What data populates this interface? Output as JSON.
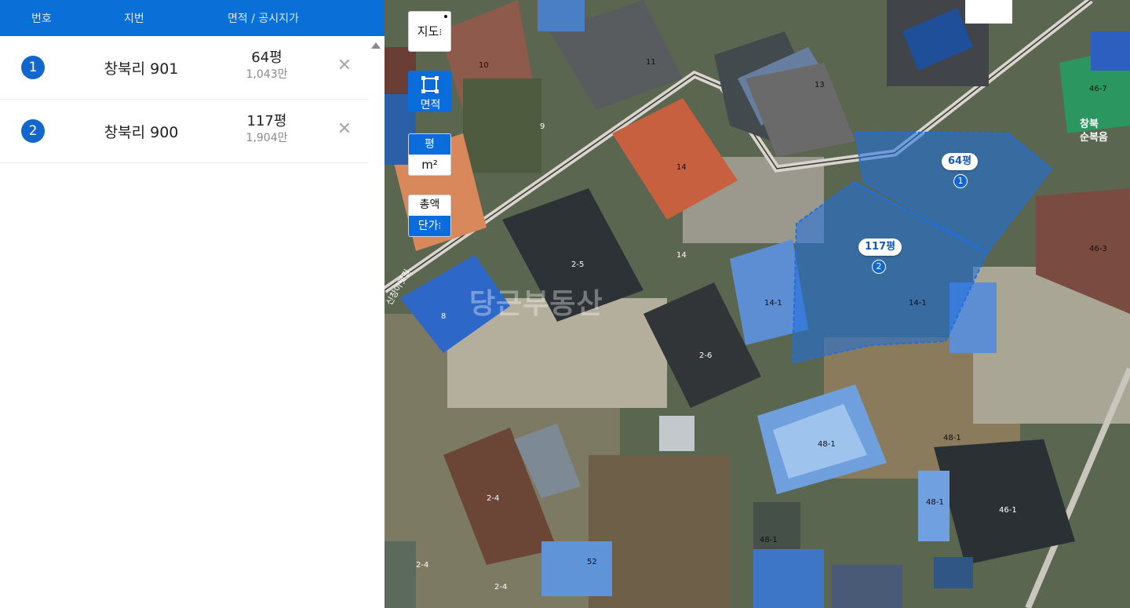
{
  "header": {
    "col_number": "번호",
    "col_jibun": "지번",
    "col_area_price": "면적 / 공시지가"
  },
  "parcels": [
    {
      "number": "1",
      "name": "창북리 901",
      "area": "64평",
      "price": "1,043만"
    },
    {
      "number": "2",
      "name": "창북리 900",
      "area": "117평",
      "price": "1,904만"
    }
  ],
  "map_controls": {
    "map_type": "지도",
    "area_tool": "면적",
    "unit_pyeong": "평",
    "unit_m2": "m²",
    "price_total": "총액",
    "price_unit": "단가"
  },
  "map_tags": [
    {
      "area": "64평",
      "number": "1"
    },
    {
      "area": "117평",
      "number": "2"
    }
  ],
  "map_parcel_numbers": {
    "p10": "10",
    "p11": "11",
    "p13": "13",
    "p9": "9",
    "p14a": "14",
    "p14b": "14",
    "p25": "2-5",
    "p8": "8",
    "p141a": "14-1",
    "p141b": "14-1",
    "p26": "2-6",
    "p481a": "48-1",
    "p481b": "48-1",
    "p481c": "48-1",
    "p481d": "48-1",
    "p461": "46-1",
    "p463": "46-3",
    "p467": "46-7",
    "p24a": "2-4",
    "p24b": "2-4",
    "p24c": "2-4",
    "p52": "52"
  },
  "map_texts": {
    "road_name": "신창아랫길",
    "watermark": "당근부동산",
    "corner_line1": "창북",
    "corner_line2": "순복음"
  },
  "colors": {
    "header_blue": "#0a6fd6",
    "badge_blue": "#1266cc",
    "parcel_fill": "#1e6fe0"
  }
}
